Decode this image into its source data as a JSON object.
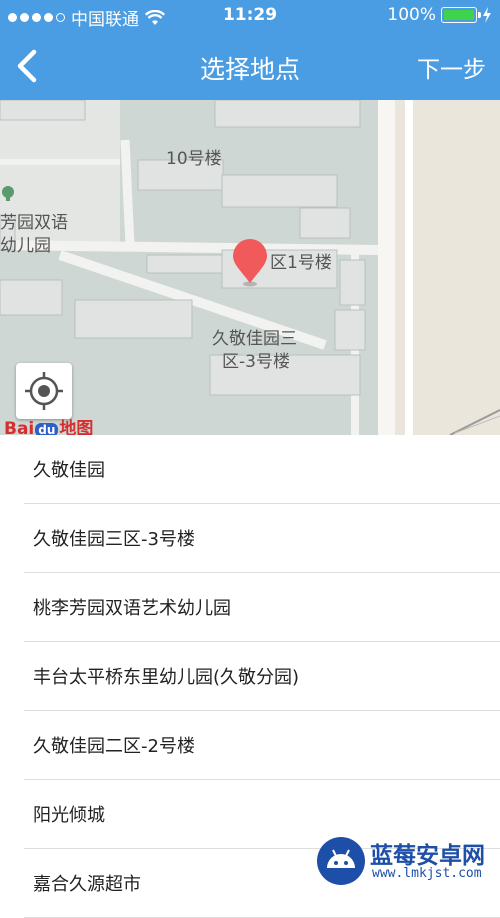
{
  "status_bar": {
    "carrier": "中国联通",
    "time": "11:29",
    "battery": "100%",
    "battery_level": 1.0
  },
  "nav": {
    "back_icon": "chevron-left-icon",
    "title": "选择地点",
    "next_label": "下一步"
  },
  "map": {
    "labels": {
      "bldg10": "10号楼",
      "kindergarten_line1": "芳园双语",
      "kindergarten_line2": "幼儿园",
      "bldg1": "区1号楼",
      "area3_line1": "久敬佳园三",
      "area3_line2": "区-3号楼"
    },
    "brand": {
      "bai": "Bai",
      "du": "du",
      "map": "地图"
    },
    "pin_color": "#f05a5a",
    "locate_icon": "locate-target-icon"
  },
  "places": [
    "久敬佳园",
    "久敬佳园三区-3号楼",
    "桃李芳园双语艺术幼儿园",
    "丰台太平桥东里幼儿园(久敬分园)",
    "久敬佳园二区-2号楼",
    "阳光倾城",
    "嘉合久源超市"
  ],
  "watermark": {
    "name": "蓝莓安卓网",
    "url": "www.lmkjst.com"
  },
  "colors": {
    "accent": "#4a9de2",
    "battery_fill": "#3fd34b"
  }
}
